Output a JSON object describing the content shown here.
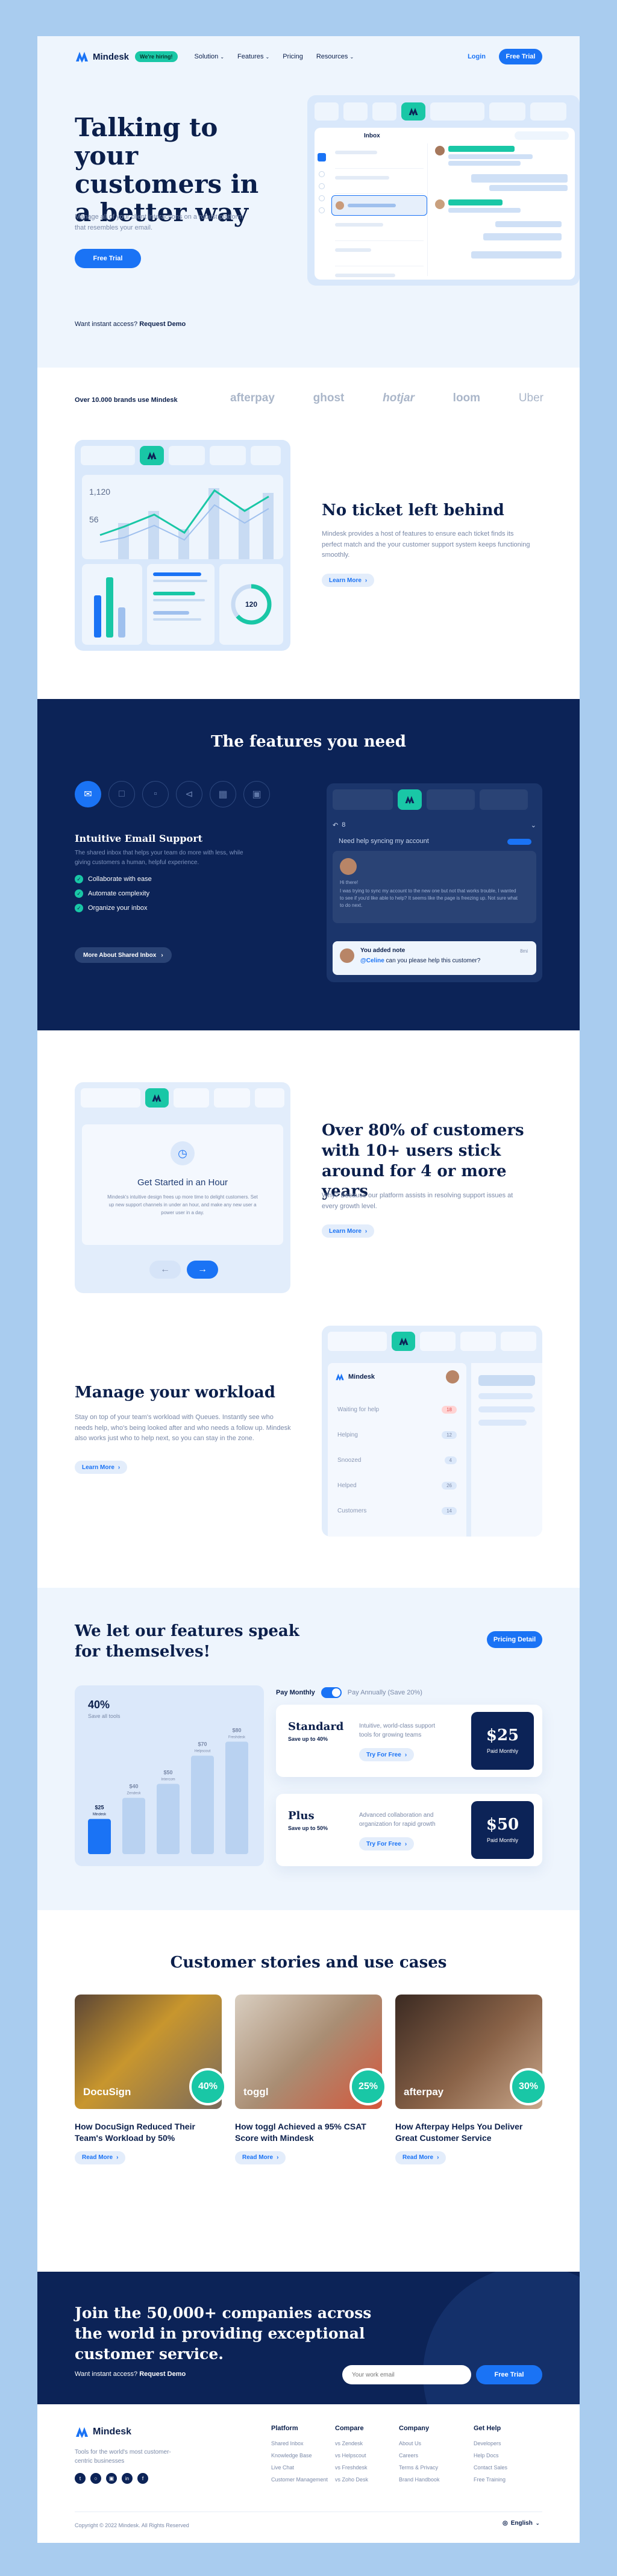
{
  "nav": {
    "brand": "Mindesk",
    "badge": "We're hiring!",
    "items": [
      "Solution",
      "Features",
      "Pricing",
      "Resources"
    ],
    "login": "Login",
    "cta": "Free Trial"
  },
  "hero": {
    "title": "Talking to your customers in a better way",
    "subtitle": "Manage all of your client interactions on a robust platform that resembles your email.",
    "cta": "Free Trial",
    "access_q": "Want instant access?",
    "access_link": "Request Demo",
    "mock_inbox": "Inbox"
  },
  "brands": {
    "label": "Over 10.000 brands use Mindesk",
    "logos": [
      "afterpay",
      "ghost",
      "hotjar",
      "loom",
      "Uber"
    ]
  },
  "ticket": {
    "title": "No ticket left behind",
    "body": "Mindesk provides a host of features to ensure each ticket finds its perfect match and the your customer support system keeps functioning smoothly.",
    "link": "Learn More",
    "n1": "1,120",
    "n2": "56",
    "gauge": "120"
  },
  "features": {
    "title": "The features you need",
    "subtitle": "Intuitive Email Support",
    "desc": "The shared inbox that helps your team do more with less, while giving customers a human, helpful experience.",
    "checks": [
      "Collaborate with ease",
      "Automate complexity",
      "Organize your inbox"
    ],
    "button": "More About Shared Inbox",
    "mock_count": "8",
    "mock_subject": "Need help syncing my account",
    "mock_greeting": "Hi there!",
    "mock_msg": "I was trying to sync my account to the new one but not that works trouble, I wanted to see if you'd like able to help? It seems like the page is freezing up. Not sure what to do next.",
    "note_title": "You added note",
    "note_time": "8mi",
    "note_mention": "@Celine",
    "note_text": "can you please help this customer?"
  },
  "stats": {
    "title": "Over 80% of customers with 10+ users stick around for 4 or more years",
    "body": "Why? Because our platform assists in resolving support issues at every growth level.",
    "link": "Learn More",
    "card_title": "Get Started in an Hour",
    "card_text": "Mindesk's intuitive design frees up more time to delight customers. Set up new support channels in under an hour, and make any new user a power user in a day."
  },
  "workload": {
    "title": "Manage your workload",
    "body": "Stay on top of your team's workload with Queues. Instantly see who needs help, who's being looked after and who needs a follow up. Mindesk also works just who to help next, so you can stay in the zone.",
    "link": "Learn More",
    "mock_brand": "Mindesk",
    "queues": [
      {
        "label": "Waiting for help",
        "count": "18"
      },
      {
        "label": "Helping",
        "count": "12"
      },
      {
        "label": "Snoozed",
        "count": "4"
      },
      {
        "label": "Helped",
        "count": "26"
      },
      {
        "label": "Customers",
        "count": "14"
      }
    ]
  },
  "pricing": {
    "title": "We let our features speak for themselves!",
    "detail_btn": "Pricing Detail",
    "pct": "40%",
    "pct_label": "Save all tools",
    "bars": [
      {
        "price": "$25",
        "label": "Mindesk"
      },
      {
        "price": "$40",
        "label": "Zendesk"
      },
      {
        "price": "$50",
        "label": "Intercom"
      },
      {
        "price": "$70",
        "label": "Helpscout"
      },
      {
        "price": "$80",
        "label": "Freshdesk"
      }
    ],
    "toggle_monthly": "Pay Monthly",
    "toggle_annually": "Pay Annually (Save 20%)",
    "plans": [
      {
        "name": "Standard",
        "save": "Save up to 40%",
        "desc": "Intuitive, world-class support tools for growing teams",
        "btn": "Try For Free",
        "price": "$25",
        "period": "Paid Monthly"
      },
      {
        "name": "Plus",
        "save": "Save up to 50%",
        "desc": "Advanced collaboration and organization for rapid growth",
        "btn": "Try For Free",
        "price": "$50",
        "period": "Paid Monthly"
      }
    ]
  },
  "stories": {
    "title": "Customer stories and use cases",
    "items": [
      {
        "brand": "DocuSign",
        "pct": "40%",
        "title": "How DocuSign Reduced Their Team's Workload by 50%",
        "link": "Read More"
      },
      {
        "brand": "toggl",
        "pct": "25%",
        "title": "How toggl Achieved a 95% CSAT Score with Mindesk",
        "link": "Read More"
      },
      {
        "brand": "afterpay",
        "pct": "30%",
        "title": "How Afterpay Helps You Deliver Great Customer Service",
        "link": "Read More"
      }
    ]
  },
  "cta": {
    "title": "Join the 50,000+ companies across the world in providing exceptional customer service.",
    "access_q": "Want instant access?",
    "access_link": "Request Demo",
    "email_placeholder": "Your work email",
    "btn": "Free Trial"
  },
  "footer": {
    "brand": "Mindesk",
    "tagline": "Tools for the world's most customer-centric businesses",
    "columns": [
      {
        "title": "Platform",
        "links": [
          "Shared Inbox",
          "Knowledge Base",
          "Live Chat",
          "Customer Management"
        ]
      },
      {
        "title": "Compare",
        "links": [
          "vs Zendesk",
          "vs Helpscout",
          "vs Freshdesk",
          "vs Zoho Desk"
        ]
      },
      {
        "title": "Company",
        "links": [
          "About Us",
          "Careers",
          "Terms & Privacy",
          "Brand Handbook"
        ]
      },
      {
        "title": "Get Help",
        "links": [
          "Developers",
          "Help Docs",
          "Contact Sales",
          "Free Training"
        ]
      }
    ],
    "copyright": "Copyright © 2022 Mindesk. All Rights Reserved",
    "lang": "English"
  },
  "colors": {
    "navy": "#0c2357",
    "blue": "#1a73f5",
    "teal": "#19c7a6",
    "page_bg": "#a9ccef",
    "light_bg": "#eef5fd"
  }
}
